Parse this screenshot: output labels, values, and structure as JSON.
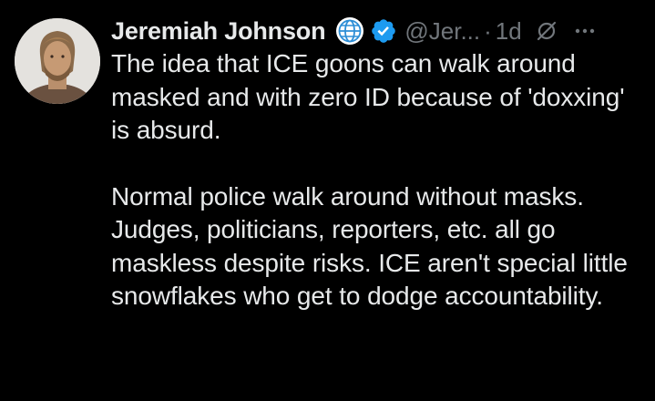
{
  "tweet": {
    "author": {
      "display_name": "Jeremiah Johnson",
      "handle": "@Jer...",
      "badges": [
        "globe-icon",
        "verified-badge-icon"
      ]
    },
    "separator": "·",
    "timestamp": "1d",
    "paragraphs": [
      "The idea that ICE goons can walk around masked and with zero ID because of 'doxxing' is absurd.",
      "Normal police walk around without masks. Judges, politicians, reporters, etc. all go maskless despite risks. ICE aren't special little snowflakes who get to dodge accountability."
    ],
    "icons": {
      "grok": "grok-icon",
      "more": "more-options-icon"
    }
  },
  "colors": {
    "background": "#000000",
    "text": "#e7e9ea",
    "secondary_text": "#71767b",
    "verified_blue": "#1d9bf0"
  }
}
